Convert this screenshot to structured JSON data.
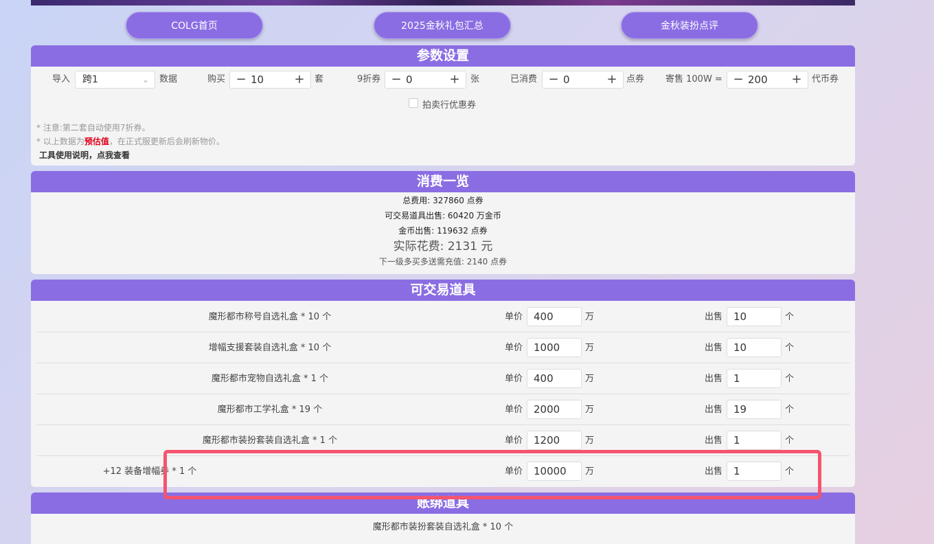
{
  "nav": {
    "home": "COLG首页",
    "gift_summary": "2025金秋礼包汇总",
    "outfit_review": "金秋装扮点评"
  },
  "settings": {
    "title": "参数设置",
    "import_label": "导入",
    "import_value": "跨1",
    "data_label": "数据",
    "buy_label": "购买",
    "buy_value": "10",
    "buy_unit": "套",
    "discount_label": "9折券",
    "discount_value": "0",
    "discount_unit": "张",
    "spent_label": "已消费",
    "spent_value": "0",
    "spent_unit": "点券",
    "rate_label": "寄售 100W =",
    "rate_value": "200",
    "rate_unit": "代币券",
    "auction_coupon_label": "拍卖行优惠券",
    "notes": {
      "note1": "* 注意:第二套自动使用7折券。",
      "note2_prefix": "* 以上数据为",
      "note2_em": "预估值",
      "note2_suffix": "，在正式服更新后会刷新物价。",
      "help_link": "工具使用说明，点我查看"
    }
  },
  "summary": {
    "title": "消费一览",
    "total": "总费用: 327860 点券",
    "tradable_sale": "可交易道具出售: 60420 万金币",
    "gold_sale": "金币出售: 119632 点券",
    "actual_cost": "实际花费: 2131 元",
    "next_tier": "下一级多买多送需充值: 2140 点券"
  },
  "tradable": {
    "title": "可交易道具",
    "price_label": "单价",
    "price_unit": "万",
    "sell_label": "出售",
    "sell_unit": "个",
    "items": [
      {
        "name": "魔形都市称号自选礼盒 * 10 个",
        "price": "400",
        "sell": "10"
      },
      {
        "name": "增幅支援套装自选礼盒 * 10 个",
        "price": "1000",
        "sell": "10"
      },
      {
        "name": "魔形都市宠物自选礼盒 * 1 个",
        "price": "400",
        "sell": "1"
      },
      {
        "name": "魔形都市工学礼盒 * 19 个",
        "price": "2000",
        "sell": "19"
      },
      {
        "name": "魔形都市装扮套装自选礼盒 * 1 个",
        "price": "1200",
        "sell": "1"
      },
      {
        "name": "+12 装备增幅券 * 1 个",
        "price": "10000",
        "sell": "1"
      }
    ]
  },
  "bound": {
    "title": "账绑道具",
    "items": [
      {
        "name": "魔形都市装扮套装自选礼盒 * 10 个"
      }
    ]
  }
}
